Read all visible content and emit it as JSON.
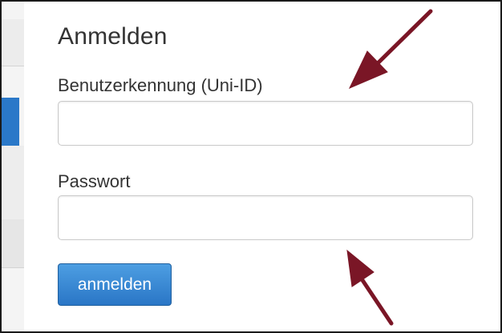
{
  "login": {
    "title": "Anmelden",
    "username_label": "Benutzerkennung (Uni-ID)",
    "username_value": "",
    "password_label": "Passwort",
    "password_value": "",
    "submit_label": "anmelden"
  },
  "colors": {
    "arrow": "#7a1626",
    "button": "#2f7fcf",
    "sidebar_accent": "#2a78c8"
  },
  "icons": {
    "annotation_arrow_top": "arrow-down-left-icon",
    "annotation_arrow_bottom": "arrow-up-left-icon"
  }
}
